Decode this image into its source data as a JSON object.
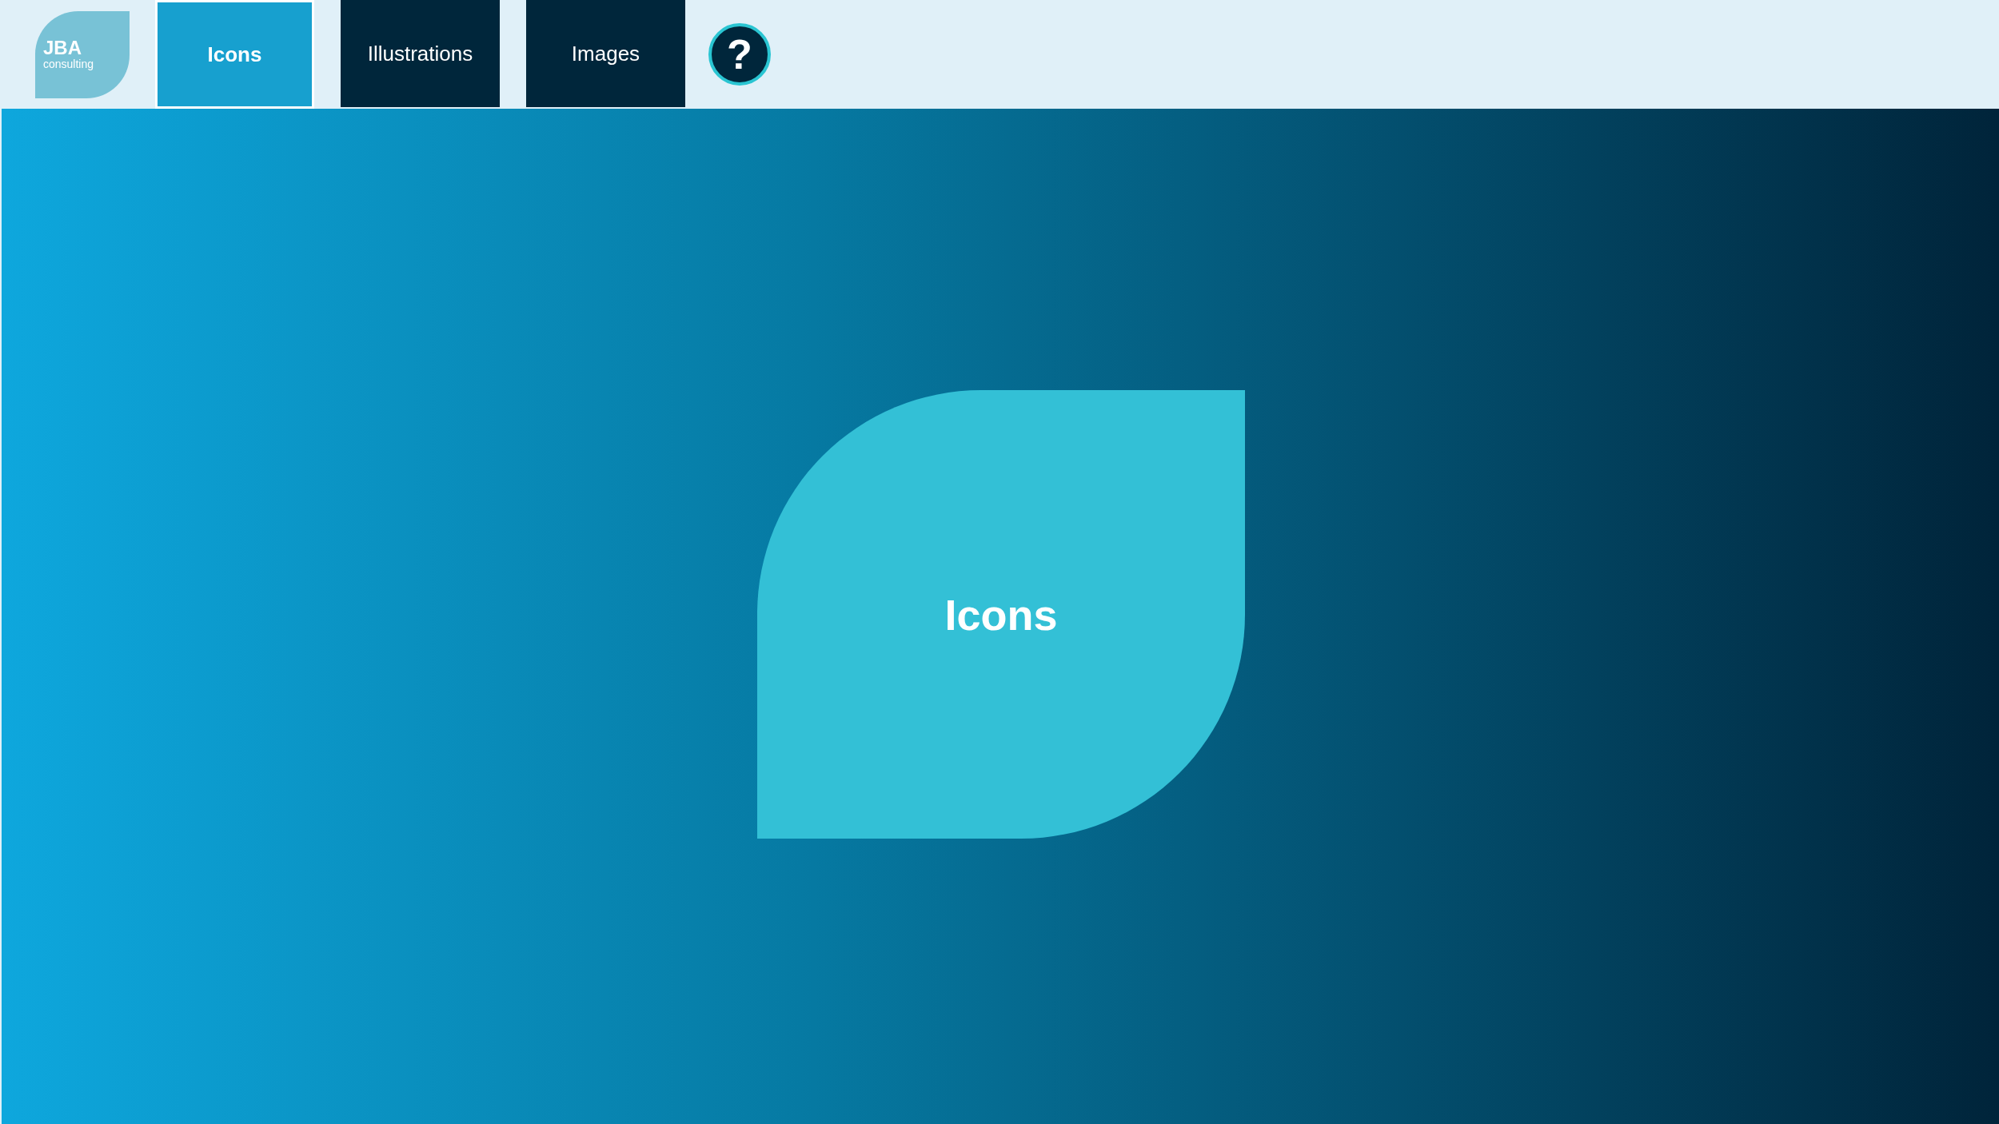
{
  "logo": {
    "name": "JBA",
    "tagline": "consulting"
  },
  "tabs": [
    {
      "label": "Icons",
      "selected": true
    },
    {
      "label": "Illustrations",
      "selected": false
    },
    {
      "label": "Images",
      "selected": false
    }
  ],
  "help": {
    "symbol": "?"
  },
  "panel": {
    "title": "Icons"
  }
}
